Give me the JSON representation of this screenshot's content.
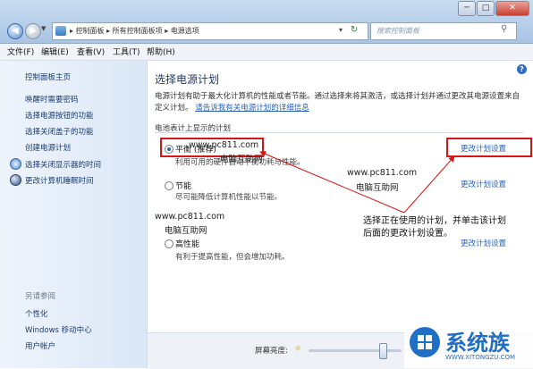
{
  "window": {
    "breadcrumb": [
      "控制面板",
      "所有控制面板项",
      "电源选项"
    ],
    "search_placeholder": "搜索控制面板",
    "controls": {
      "minimize": "─",
      "maximize": "□",
      "close": "✕"
    }
  },
  "menu": [
    "文件(F)",
    "编辑(E)",
    "查看(V)",
    "工具(T)",
    "帮助(H)"
  ],
  "sidebar": {
    "home": "控制面板主页",
    "items": [
      "唤醒时需要密码",
      "选择电源按钮的功能",
      "选择关闭盖子的功能",
      "创建电源计划",
      "选择关闭显示器的时间",
      "更改计算机睡眠时间"
    ],
    "see_also_title": "另请参阅",
    "see_also": [
      "个性化",
      "Windows 移动中心",
      "用户帐户"
    ]
  },
  "main": {
    "title": "选择电源计划",
    "description": "电源计划有助于最大化计算机的性能或者节能。通过选择来将其激活，或选择计划并通过更改其电源设置来自定义计划。",
    "description_link": "请告诉我有关电源计划的详细信息",
    "section_title": "电池表计上显示的计划",
    "plans": [
      {
        "name": "平衡 (推荐)",
        "desc": "利用可用的硬件自动平衡功耗与性能。",
        "selected": true,
        "link": "更改计划设置"
      },
      {
        "name": "节能",
        "desc": "尽可能降低计算机性能以节能。",
        "selected": false,
        "link": "更改计划设置"
      },
      {
        "name": "高性能",
        "desc": "有利于提高性能，但会增加功耗。",
        "selected": false,
        "link": "更改计划设置"
      }
    ],
    "brightness_label": "屏幕亮度:",
    "brightness_level": 0.8
  },
  "annotation": {
    "line1": "选择正在使用的计划，并单击该计划",
    "line2": "后面的更改计划设置。"
  },
  "watermarks": {
    "url": "www.pc811.com",
    "name": "电脑互助网"
  },
  "logo": {
    "text": "系统族",
    "url": "WWW.XITONGZU.COM"
  },
  "colors": {
    "accent": "#2a63b6",
    "highlight": "#d91414"
  }
}
